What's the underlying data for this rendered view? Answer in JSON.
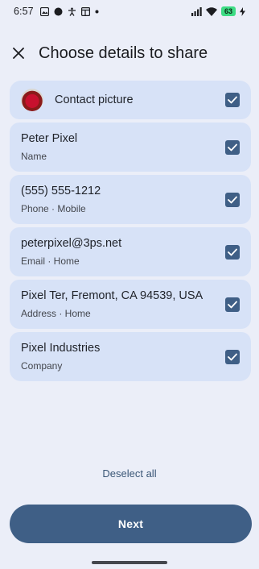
{
  "status_bar": {
    "time": "6:57",
    "battery": "63"
  },
  "header": {
    "title": "Choose details to share",
    "close_icon": "close-icon"
  },
  "items": [
    {
      "primary": "Contact picture",
      "checked": true
    },
    {
      "primary": "Peter Pixel",
      "secondary": "Name",
      "checked": true
    },
    {
      "primary": "(555) 555-1212",
      "secondary": "Phone · Mobile",
      "checked": true
    },
    {
      "primary": "peterpixel@3ps.net",
      "secondary": "Email · Home",
      "checked": true
    },
    {
      "primary": "Pixel Ter, Fremont, CA 94539, USA",
      "secondary": "Address · Home",
      "checked": true
    },
    {
      "primary": "Pixel Industries",
      "secondary": "Company",
      "checked": true
    }
  ],
  "actions": {
    "deselect_all": "Deselect all",
    "next": "Next"
  },
  "colors": {
    "background": "#ebeef8",
    "card": "#d7e2f7",
    "accent": "#3f5f86"
  }
}
